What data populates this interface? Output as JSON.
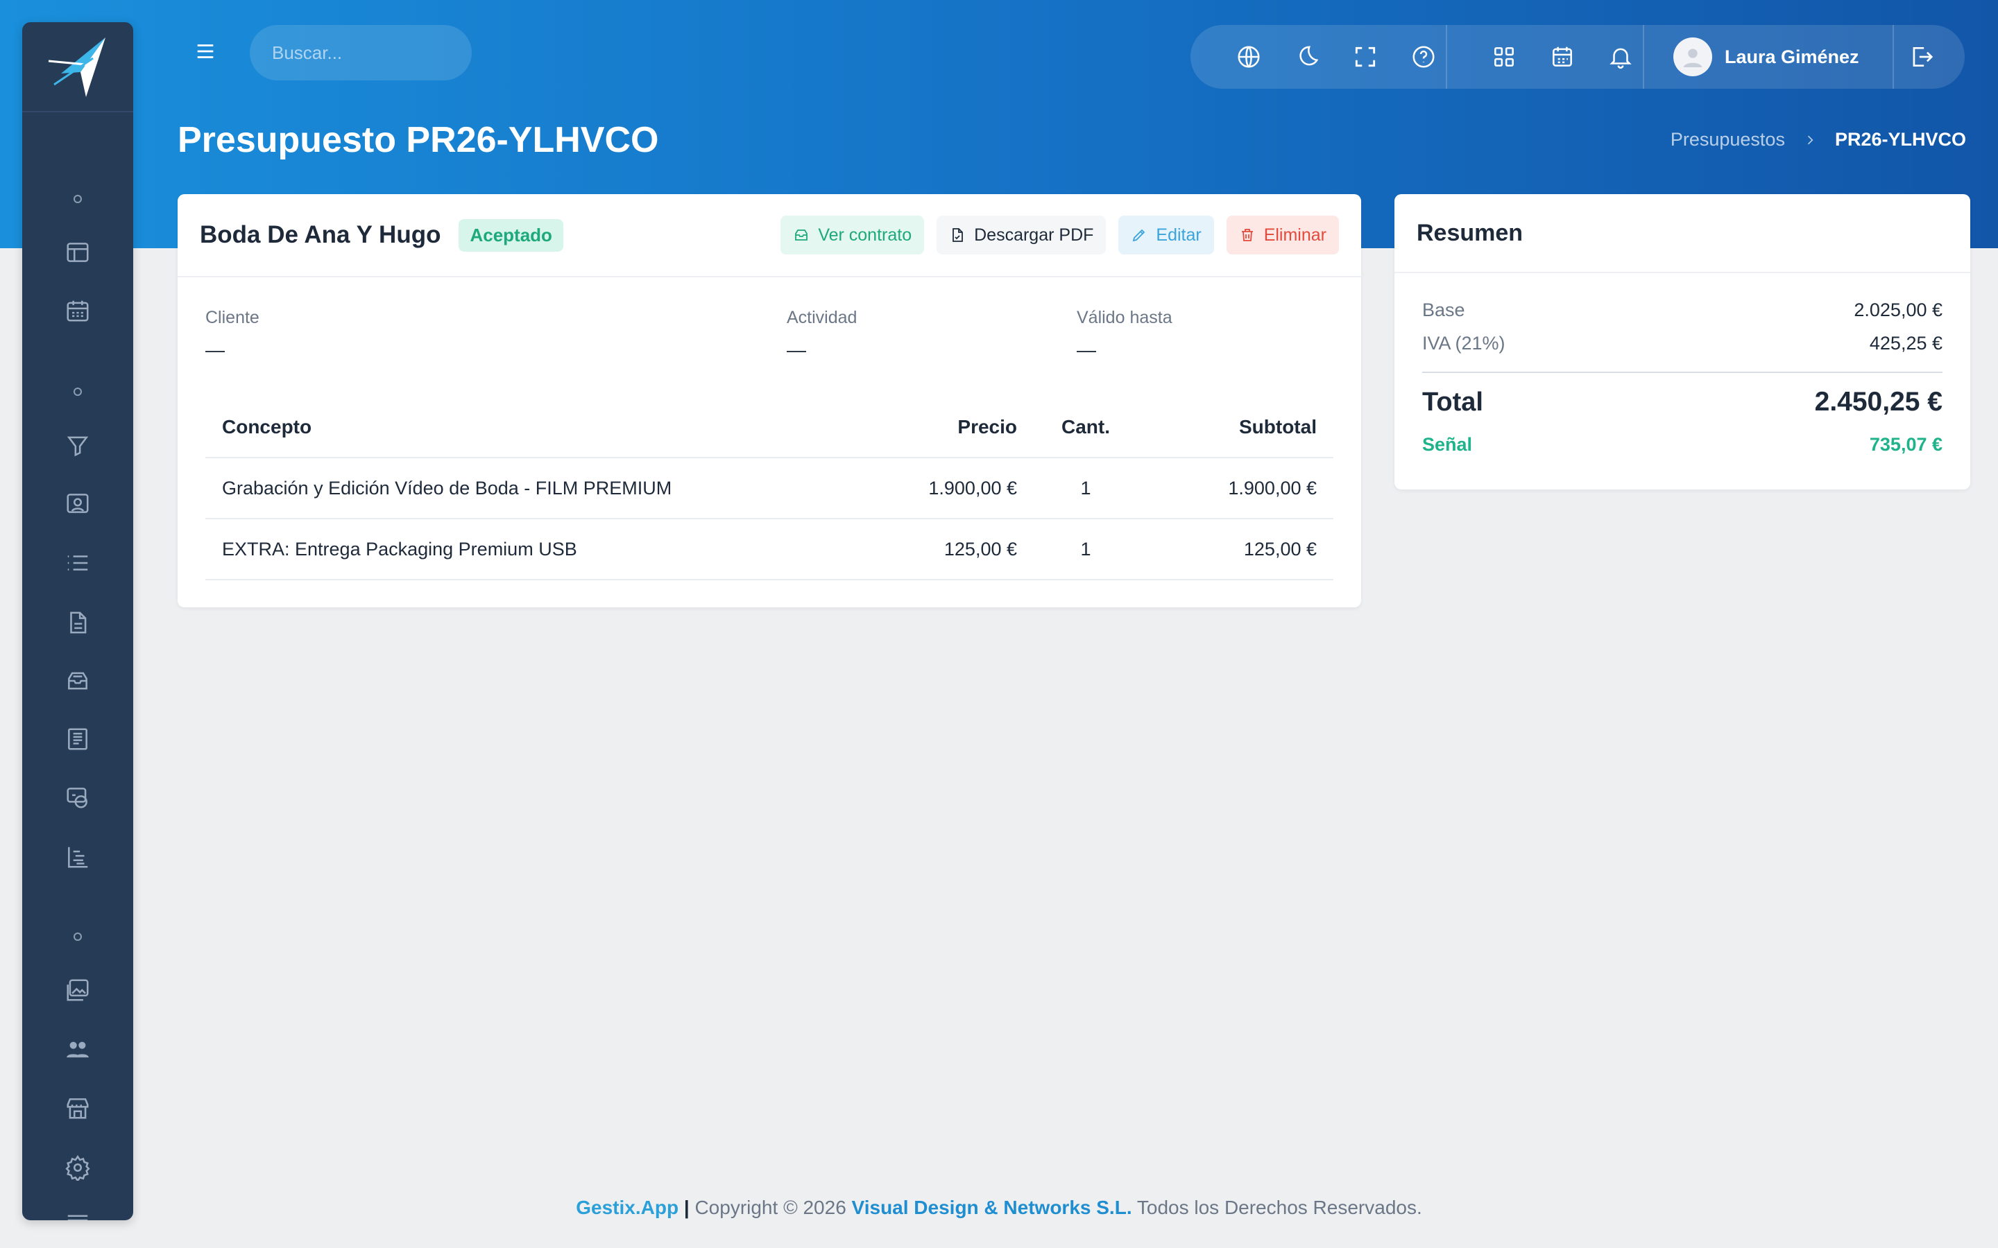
{
  "app": {
    "name": "Gestix.App"
  },
  "search": {
    "placeholder": "Buscar..."
  },
  "user": {
    "name": "Laura Giménez"
  },
  "page": {
    "title": "Presupuesto PR26-YLHVCO",
    "breadcrumb": [
      "Presupuestos",
      "PR26-YLHVCO"
    ]
  },
  "quote": {
    "event_title": "Boda De Ana Y Hugo",
    "status": "Aceptado",
    "actions": {
      "contract": "Ver contrato",
      "pdf": "Descargar PDF",
      "edit": "Editar",
      "delete": "Eliminar"
    },
    "meta": [
      {
        "label": "Cliente",
        "value": "—"
      },
      {
        "label": "Actividad",
        "value": "—"
      },
      {
        "label": "Válido hasta",
        "value": "—"
      }
    ],
    "table": {
      "headers": [
        "Concepto",
        "Precio",
        "Cant.",
        "Subtotal"
      ],
      "rows": [
        {
          "concept": "Grabación y Edición Vídeo de Boda - FILM PREMIUM",
          "price": "1.900,00 €",
          "qty": "1",
          "subtotal": "1.900,00 €"
        },
        {
          "concept": "EXTRA: Entrega Packaging Premium USB",
          "price": "125,00 €",
          "qty": "1",
          "subtotal": "125,00 €"
        }
      ]
    }
  },
  "summary": {
    "title": "Resumen",
    "base_label": "Base",
    "base_value": "2.025,00 €",
    "vat_label": "IVA (21%)",
    "vat_value": "425,25 €",
    "total_label": "Total",
    "total_value": "2.450,25 €",
    "deposit_label": "Señal",
    "deposit_value": "735,07 €"
  },
  "footer": {
    "brand": "Gestix.App",
    "separator": "|",
    "copyright": "Copyright © 2026",
    "company": "Visual Design & Networks S.L.",
    "rights": "Todos los Derechos Reservados."
  },
  "icons": {
    "sidebar": [
      "dashboard-icon",
      "calendar-icon",
      "filter-icon",
      "contacts-icon",
      "list-icon",
      "document-icon",
      "inbox-icon",
      "invoice-icon",
      "money-icon",
      "gantt-icon",
      "gallery-icon",
      "users-icon",
      "store-icon",
      "settings-icon",
      "log-icon"
    ],
    "toolbar": [
      "globe-icon",
      "moon-icon",
      "fullscreen-icon",
      "help-icon",
      "apps-icon",
      "calendar-icon",
      "bell-icon"
    ]
  },
  "colors": {
    "accent": "#1570c4",
    "sidebar": "#263b55",
    "success": "#1ea97c",
    "danger": "#e24b3b",
    "info": "#3aa4dd"
  }
}
